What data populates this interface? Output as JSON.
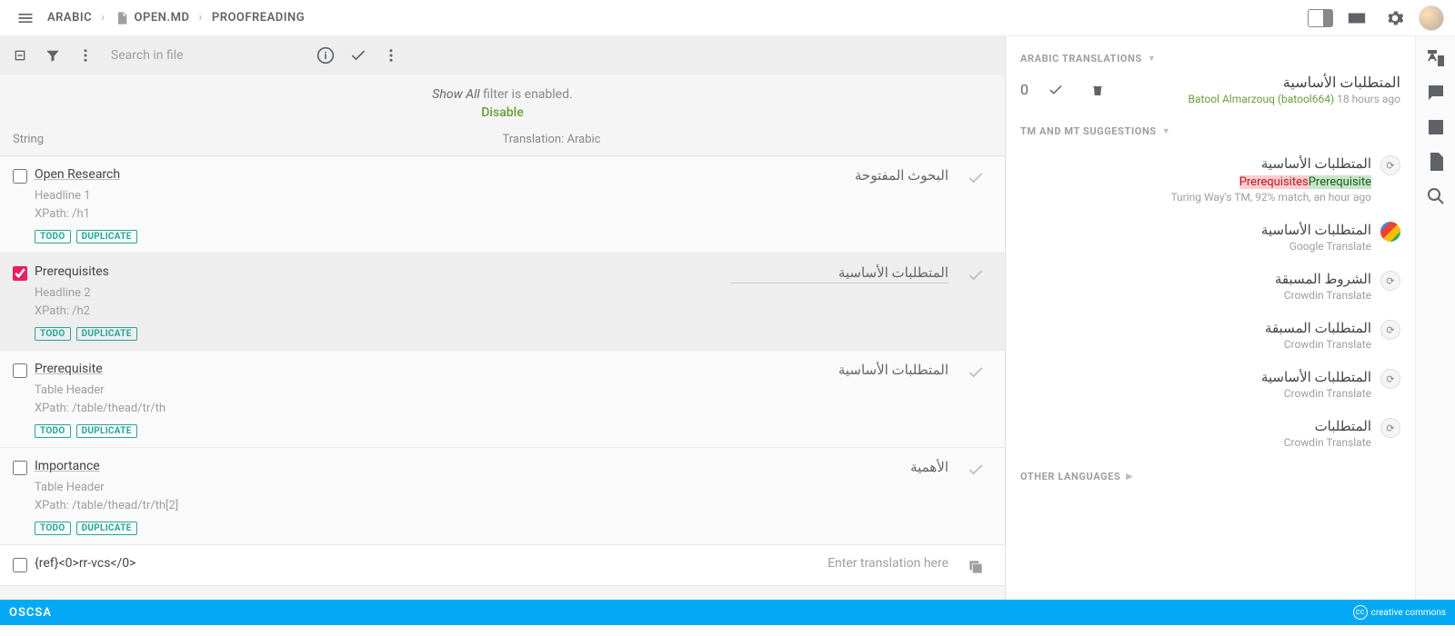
{
  "breadcrumb": {
    "lang": "ARABIC",
    "file": "OPEN.MD",
    "mode": "PROOFREADING"
  },
  "toolbar": {
    "search_placeholder": "Search in file"
  },
  "filter": {
    "prefix": "Show All",
    "suffix": " filter is enabled.",
    "disable": "Disable"
  },
  "columns": {
    "string": "String",
    "translation": "Translation: Arabic"
  },
  "tags": {
    "todo": "TODO",
    "dup": "DUPLICATE"
  },
  "rows": [
    {
      "title": "Open Research",
      "meta1": "Headline 1",
      "meta2": "XPath: /h1",
      "tr": "البحوث المفتوحة",
      "checked": false,
      "selected": false,
      "placeholder": ""
    },
    {
      "title": "Prerequisites",
      "meta1": "Headline 2",
      "meta2": "XPath: /h2",
      "tr": "المتطلبات الأساسية",
      "checked": true,
      "selected": true,
      "placeholder": ""
    },
    {
      "title": "Prerequisite",
      "meta1": "Table Header",
      "meta2": "XPath: /table/thead/tr/th",
      "tr": "المتطلبات الأساسية",
      "checked": false,
      "selected": false,
      "placeholder": ""
    },
    {
      "title": "Importance",
      "meta1": "Table Header",
      "meta2": "XPath: /table/thead/tr/th[2]",
      "tr": "الأهمية",
      "checked": false,
      "selected": false,
      "placeholder": ""
    },
    {
      "title": "{ref}<0>rr-vcs</0>",
      "meta1": "",
      "meta2": "",
      "tr": "",
      "checked": false,
      "selected": false,
      "placeholder": "Enter translation here"
    }
  ],
  "side": {
    "sec1": "ARABIC TRANSLATIONS",
    "count": "0",
    "current_ar": "المتطلبات الأساسية",
    "author": "Batool Almarzouq (batool664)",
    "author_time": "18 hours ago",
    "sec2": "TM AND MT SUGGESTIONS",
    "sec3": "OTHER LANGUAGES",
    "tm_src": "Turing Way's TM, 92% match, an hour ago",
    "diff_del": "Prerequisites",
    "diff_add": "Prerequisite",
    "suggestions": [
      {
        "ar": "المتطلبات الأساسية",
        "src": "Google Translate",
        "ptype": "g"
      },
      {
        "ar": "الشروط المسبقة",
        "src": "Crowdin Translate",
        "ptype": "c"
      },
      {
        "ar": "المتطلبات المسبقة",
        "src": "Crowdin Translate",
        "ptype": "c"
      },
      {
        "ar": "المتطلبات الأساسية",
        "src": "Crowdin Translate",
        "ptype": "c"
      },
      {
        "ar": "المتطلبات",
        "src": "Crowdin Translate",
        "ptype": "c"
      }
    ]
  },
  "footer": {
    "brand": "OSCSA",
    "cc": "creative commons"
  }
}
